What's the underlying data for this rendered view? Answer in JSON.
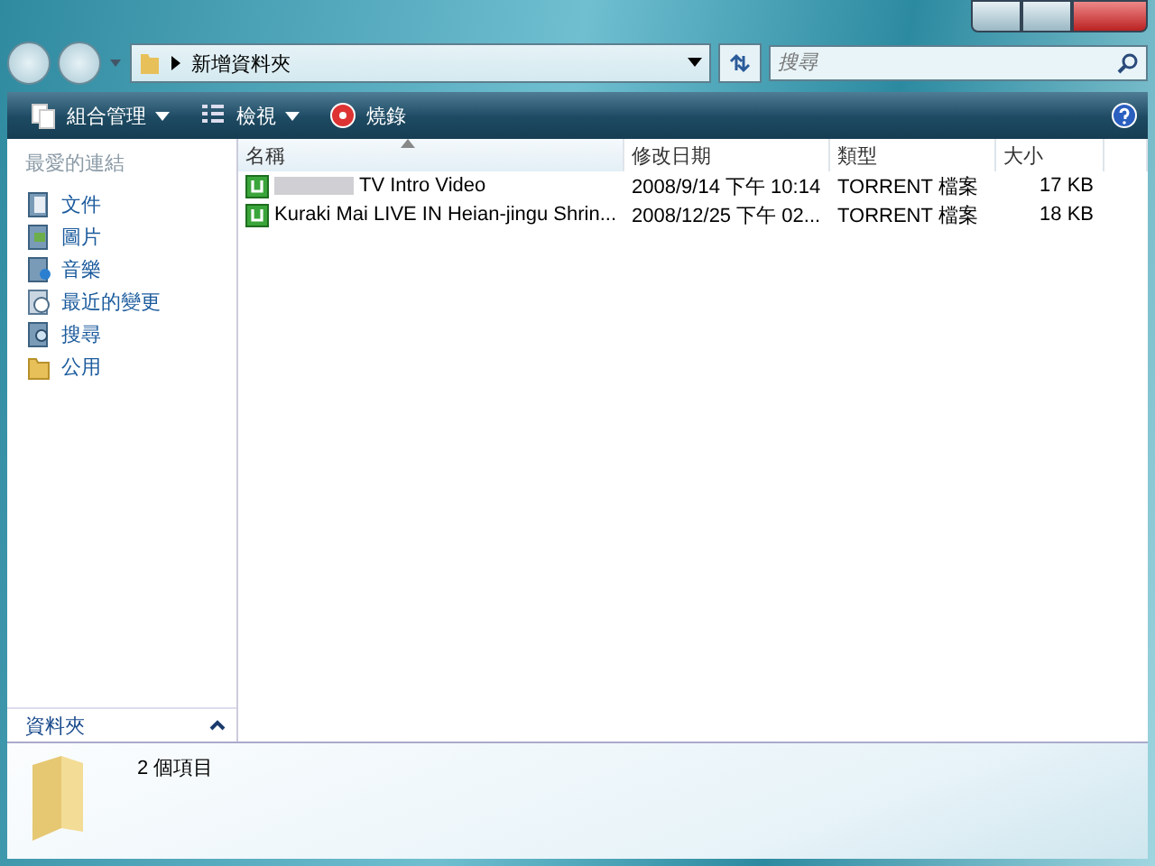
{
  "address_bar": {
    "path": "新增資料夾",
    "search_placeholder": "搜尋"
  },
  "toolbar": {
    "buttons": [
      {
        "label": "組合管理",
        "kind": "organize",
        "dropdown": true
      },
      {
        "label": "檢視",
        "kind": "views",
        "dropdown": true
      },
      {
        "label": "燒錄",
        "kind": "burn",
        "dropdown": false
      }
    ]
  },
  "sidebar": {
    "title": "最愛的連結",
    "items": [
      {
        "label": "文件",
        "kind": "documents"
      },
      {
        "label": "圖片",
        "kind": "pictures"
      },
      {
        "label": "音樂",
        "kind": "music"
      },
      {
        "label": "最近的變更",
        "kind": "recent"
      },
      {
        "label": "搜尋",
        "kind": "search"
      },
      {
        "label": "公用",
        "kind": "folder"
      }
    ],
    "folders_label": "資料夾"
  },
  "table": {
    "columns": [
      {
        "label": "名稱",
        "sorted": true
      },
      {
        "label": "修改日期",
        "sorted": false
      },
      {
        "label": "類型",
        "sorted": false
      },
      {
        "label": "大小",
        "sorted": false
      }
    ],
    "rows": [
      {
        "name": "TV Intro Video",
        "redacted": true,
        "modified": "2008/9/14 下午 10:14",
        "type": "TORRENT 檔案",
        "size": "17 KB"
      },
      {
        "name": "Kuraki Mai LIVE IN Heian-jingu Shrin...",
        "redacted": false,
        "modified": "2008/12/25 下午 02...",
        "type": "TORRENT 檔案",
        "size": "18 KB"
      }
    ]
  },
  "details_pane": {
    "item_count": "2 個項目"
  }
}
